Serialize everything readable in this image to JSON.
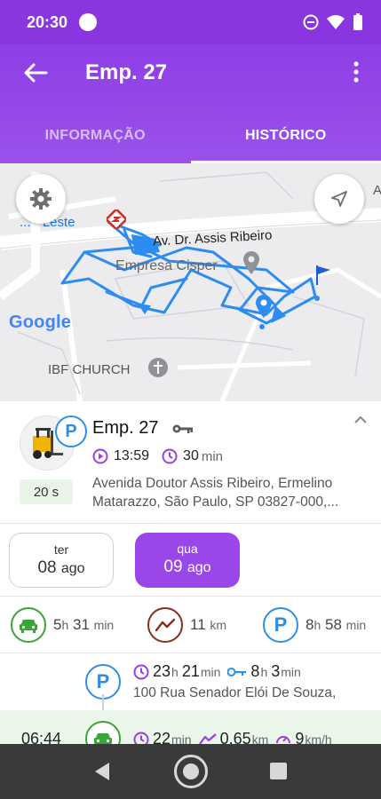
{
  "status_bar": {
    "time": "20:30",
    "icons": [
      "record-dot-icon",
      "do-not-disturb-icon",
      "wifi-icon",
      "battery-icon"
    ]
  },
  "app_bar": {
    "title": "Emp. 27",
    "tabs": [
      {
        "label": "INFORMAÇÃO",
        "active": false
      },
      {
        "label": "HISTÓRICO",
        "active": true
      }
    ],
    "colors": {
      "primary": "#8a36e0",
      "primary_light": "#9a47ea"
    }
  },
  "map": {
    "labels": {
      "station": "... - Leste",
      "avenue": "Av. Dr. Assis Ribeiro",
      "company": "Empresa Cisper",
      "church": "IBF CHURCH",
      "corner": "A"
    },
    "logo": "Google",
    "route_color": "#2d8cf0"
  },
  "vehicle": {
    "name": "Emp. 27",
    "badge": "P",
    "start_time": "13:59",
    "duration_value": "30",
    "duration_unit": "min",
    "age": "20 s",
    "address_line1": "Avenida Doutor Assis Ribeiro, Ermelino",
    "address_line2": "Matarazzo, São Paulo, SP 03827-000,..."
  },
  "days": [
    {
      "weekday": "ter",
      "day": "08",
      "month": "ago",
      "selected": false
    },
    {
      "weekday": "qua",
      "day": "09",
      "month": "ago",
      "selected": true
    }
  ],
  "stats": {
    "driving": {
      "h": "5",
      "h_unit": "h",
      "m": "31",
      "m_unit": "min",
      "color": "#3aa63a"
    },
    "distance": {
      "value": "11",
      "unit": "km",
      "color": "#8b2a1f"
    },
    "parked": {
      "h": "8",
      "h_unit": "h",
      "m": "58",
      "m_unit": "min",
      "color": "#2f8ee8"
    }
  },
  "events": [
    {
      "type": "parked",
      "icon_letter": "P",
      "duration_h": "23",
      "duration_h_unit": "h",
      "duration_m": "21",
      "duration_m_unit": "min",
      "key_h": "8",
      "key_h_unit": "h",
      "key_m": "3",
      "key_m_unit": "min",
      "address": "100 Rua Senador Elói De Souza,"
    },
    {
      "type": "driving",
      "time": "06:44",
      "duration_value": "22",
      "duration_unit": "min",
      "distance_value": "0,65",
      "distance_unit": "km",
      "speed_value": "9",
      "speed_unit": "km/h"
    }
  ]
}
